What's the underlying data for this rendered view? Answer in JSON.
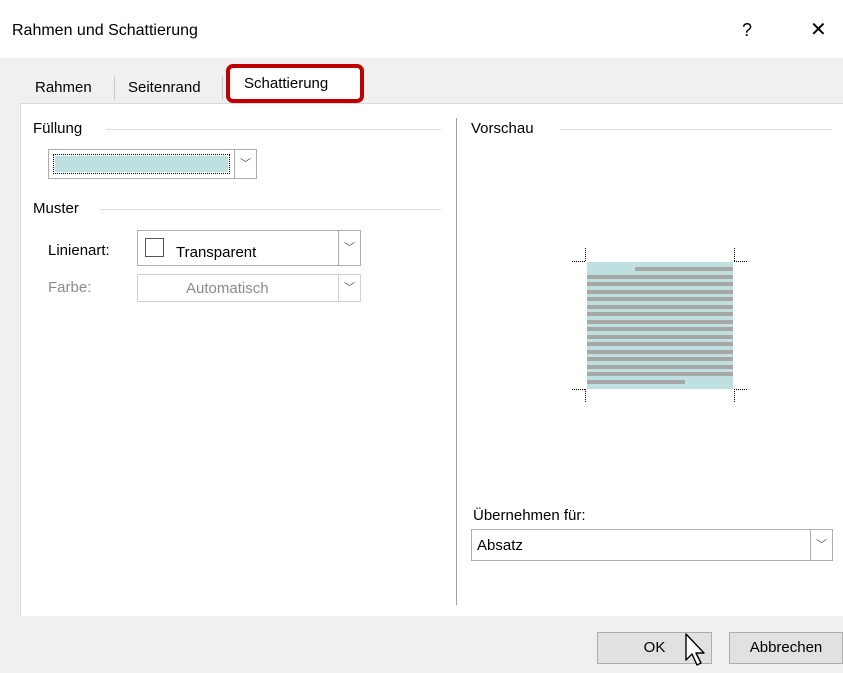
{
  "window": {
    "title": "Rahmen und Schattierung",
    "help_icon": "?",
    "close_icon": "✕"
  },
  "tabs": [
    {
      "label": "Rahmen"
    },
    {
      "label": "Seitenrand"
    },
    {
      "label": "Schattierung",
      "active": true
    }
  ],
  "fill": {
    "label": "Füllung",
    "color": "#bfe0e1"
  },
  "pattern": {
    "label": "Muster",
    "style_label": "Linienart:",
    "style_value": "Transparent",
    "color_label": "Farbe:",
    "color_value": "Automatisch"
  },
  "preview": {
    "label": "Vorschau",
    "fill_color": "#bfe0e1",
    "line_color": "#a6a6a6"
  },
  "apply": {
    "label": "Übernehmen für:",
    "value": "Absatz"
  },
  "buttons": {
    "ok": "OK",
    "cancel": "Abbrechen"
  },
  "colors": {
    "highlight": "#c00000"
  }
}
